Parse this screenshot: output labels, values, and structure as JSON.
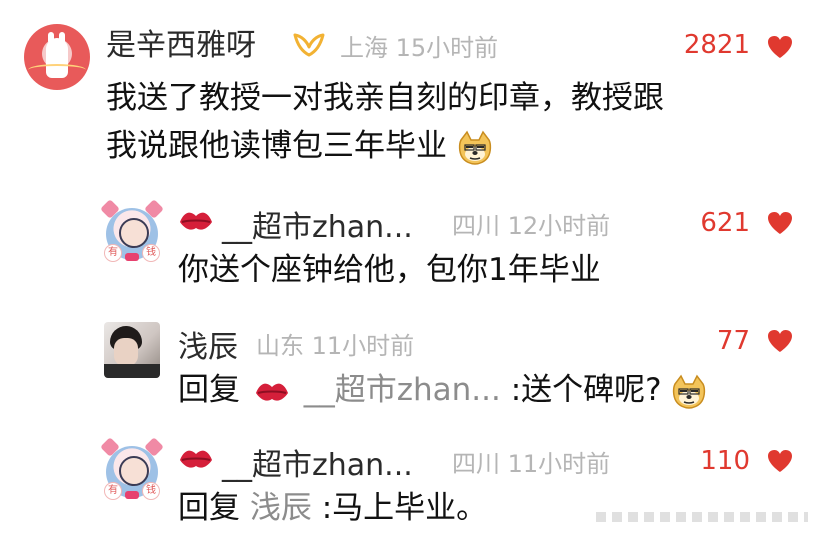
{
  "comment": {
    "username": "是辛西雅呀",
    "location": "上海",
    "time": "15小时前",
    "likes": "2821",
    "text_line1": "我送了教授一对我亲自刻的印章，教授跟",
    "text_line2": "我说跟他读博包三年毕业"
  },
  "replies": [
    {
      "username": "__超市zhan...",
      "location": "四川",
      "time": "12小时前",
      "likes": "621",
      "text": "你送个座钟给他，包你1年毕业"
    },
    {
      "username": "浅辰",
      "location": "山东",
      "time": "11小时前",
      "likes": "77",
      "reply_prefix": "回复",
      "reply_to": "__超市zhan...",
      "text": ":送个碑呢?"
    },
    {
      "username": "__超市zhan...",
      "location": "四川",
      "time": "11小时前",
      "likes": "110",
      "reply_prefix": "回复",
      "reply_to": "浅辰",
      "text": ":马上毕业。"
    }
  ],
  "badges": {
    "avatar_badge_left": "有",
    "avatar_badge_right": "钱"
  },
  "colors": {
    "like": "#e0392f",
    "meta": "#b5b5b5",
    "vip_gold": "#f2b233",
    "kiss": "#d51f3a"
  },
  "icons": [
    "heart-icon",
    "vip-icon",
    "kiss-emoji-icon",
    "doge-emoji-icon"
  ]
}
